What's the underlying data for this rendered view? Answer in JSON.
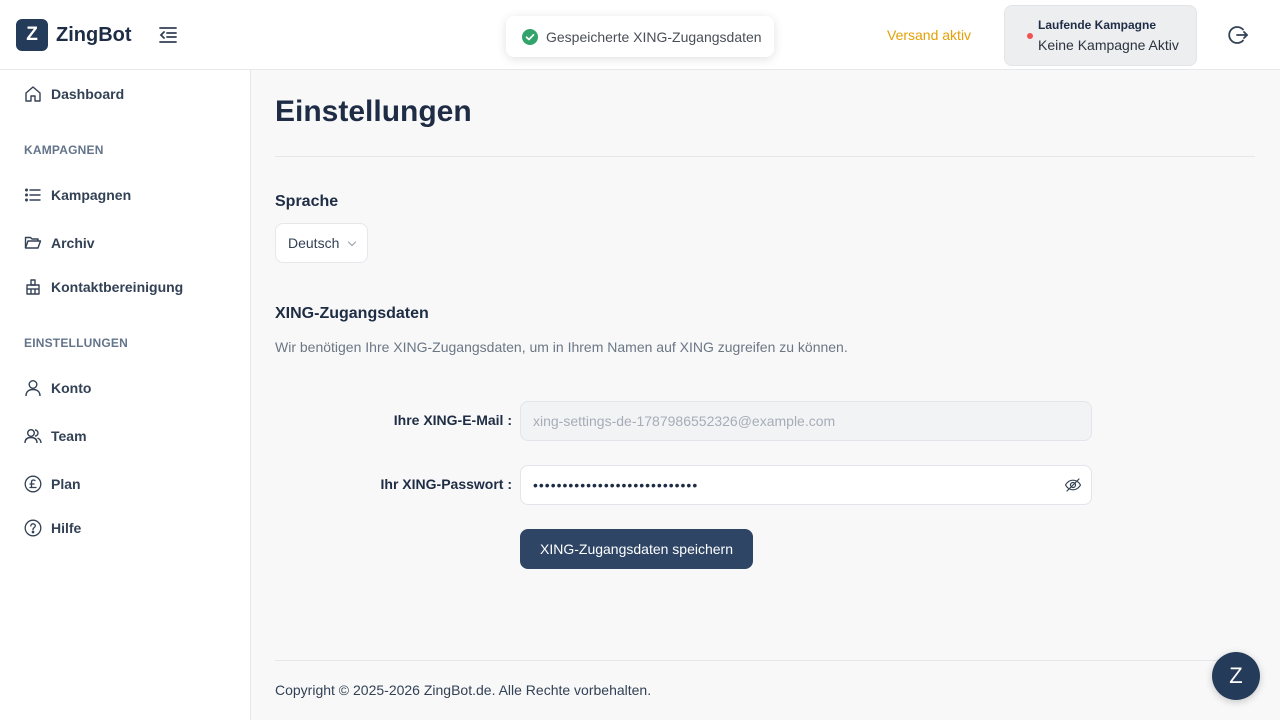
{
  "header": {
    "logo_letter": "Z",
    "app_name": "ZingBot",
    "toast_text": "Gespeicherte XING-Zugangsdaten",
    "send_status": "Versand aktiv",
    "campaign_title": "Laufende Kampagne",
    "campaign_value": "Keine Kampagne Aktiv"
  },
  "sidebar": {
    "dashboard": "Dashboard",
    "section_campaigns": "KAMPAGNEN",
    "campaigns": "Kampagnen",
    "archive": "Archiv",
    "contact_cleanup": "Kontaktbereinigung",
    "section_settings": "EINSTELLUNGEN",
    "account": "Konto",
    "team": "Team",
    "plan": "Plan",
    "help": "Hilfe"
  },
  "main": {
    "title": "Einstellungen",
    "language_heading": "Sprache",
    "language_value": "Deutsch",
    "xing_heading": "XING-Zugangsdaten",
    "xing_description": "Wir benötigen Ihre XING-Zugangsdaten, um in Ihrem Namen auf XING zugreifen zu können.",
    "email_label": "Ihre XING-E-Mail :",
    "email_placeholder": "xing-settings-de-1787986552326@example.com",
    "password_label": "Ihr XING-Passwort :",
    "password_value": "••••••••••••••••••••••••••••",
    "save_button": "XING-Zugangsdaten speichern"
  },
  "footer": {
    "copyright": "Copyright © 2025-2026 ZingBot.de. Alle Rechte vorbehalten."
  },
  "chat": {
    "letter": "Z"
  },
  "colors": {
    "primary": "#243b5a",
    "button": "#2e4566",
    "status_active": "#e3a008",
    "status_dot": "#f05252",
    "success": "#31a36b"
  }
}
